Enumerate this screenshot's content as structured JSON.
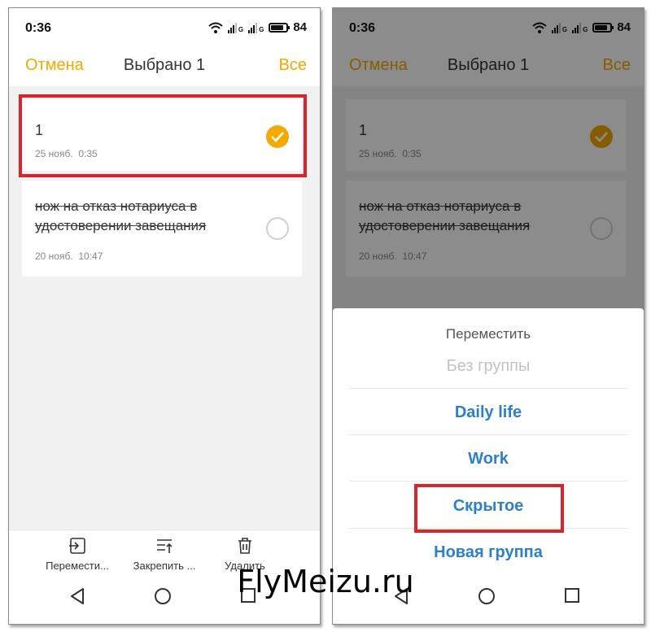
{
  "status": {
    "time": "0:36",
    "g1": "G",
    "g2": "G",
    "battery": "84"
  },
  "header": {
    "cancel": "Отмена",
    "title": "Выбрано 1",
    "select_all": "Все"
  },
  "notes": [
    {
      "title": "1",
      "date": "25 нояб.",
      "time": "0:35",
      "selected": true
    },
    {
      "body": "нож на отказ нотариуса в удостоверении завещания",
      "date": "20 нояб.",
      "time": "10:47",
      "selected": false
    }
  ],
  "actions": {
    "move": "Перемести...",
    "pin": "Закрепить ...",
    "delete": "Удалить"
  },
  "sheet": {
    "title": "Переместить",
    "options": [
      "Без группы",
      "Daily life",
      "Work",
      "Скрытое",
      "Новая группа"
    ]
  },
  "watermark": "FlyMeizu.ru",
  "colors": {
    "accent": "#f2a900",
    "link": "#2d7fc9",
    "highlight": "#d9232d"
  }
}
